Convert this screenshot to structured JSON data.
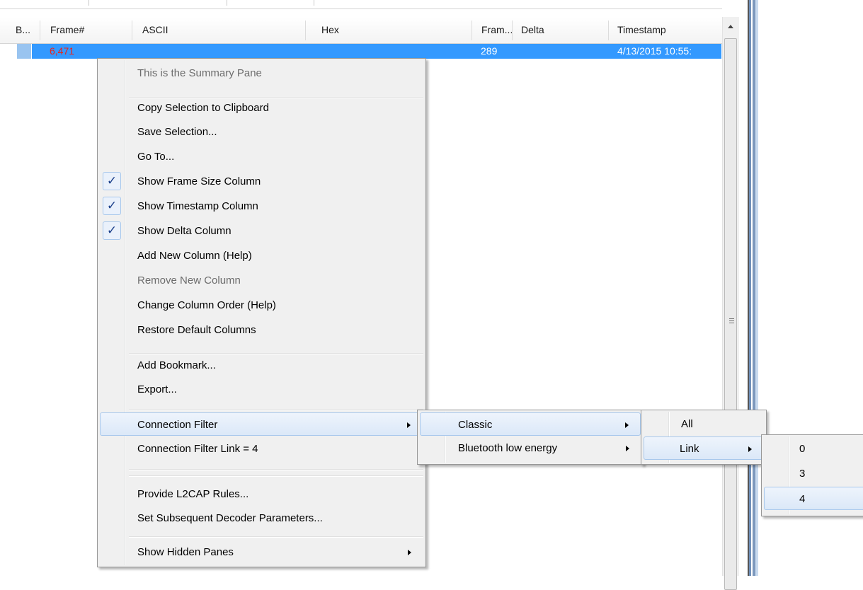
{
  "columns": [
    {
      "label": "B..."
    },
    {
      "label": "Frame#"
    },
    {
      "label": "ASCII"
    },
    {
      "label": "Hex"
    },
    {
      "label": "Fram..."
    },
    {
      "label": "Delta"
    },
    {
      "label": "Timestamp"
    }
  ],
  "row": {
    "frame": "6,471",
    "frame_size": "289",
    "timestamp": "4/13/2015 10:55:",
    "frame_color": "#e8231b",
    "selection_color": "#3399ff"
  },
  "context_menu": {
    "items": [
      {
        "label": "This is the Summary Pane",
        "disabled": true
      },
      {
        "label": "Copy Selection to Clipboard"
      },
      {
        "label": "Save Selection..."
      },
      {
        "label": "Go To..."
      },
      {
        "label": "Show Frame Size Column",
        "checked": true
      },
      {
        "label": "Show Timestamp Column",
        "checked": true
      },
      {
        "label": "Show Delta Column",
        "checked": true
      },
      {
        "label": "Add New Column (Help)"
      },
      {
        "label": "Remove New Column",
        "disabled": true
      },
      {
        "label": "Change Column Order (Help)"
      },
      {
        "label": "Restore Default Columns"
      },
      {
        "label": "Add Bookmark..."
      },
      {
        "label": "Export..."
      },
      {
        "label": "Connection Filter",
        "submenu": true,
        "highlighted": true
      },
      {
        "label": "Connection Filter  Link = 4"
      },
      {
        "label": "Provide L2CAP Rules..."
      },
      {
        "label": "Set Subsequent Decoder Parameters..."
      },
      {
        "label": "Show Hidden Panes",
        "submenu": true
      }
    ],
    "check_glyph": "✓"
  },
  "submenu_connection": {
    "items": [
      {
        "label": "Classic",
        "submenu": true,
        "highlighted": true
      },
      {
        "label": "Bluetooth low energy",
        "submenu": true
      }
    ]
  },
  "submenu_classic": {
    "items": [
      {
        "label": "All"
      },
      {
        "label": "Link",
        "submenu": true,
        "highlighted": true
      }
    ]
  },
  "submenu_link": {
    "items": [
      {
        "label": "0"
      },
      {
        "label": "3"
      },
      {
        "label": "4",
        "highlighted": true
      }
    ]
  }
}
